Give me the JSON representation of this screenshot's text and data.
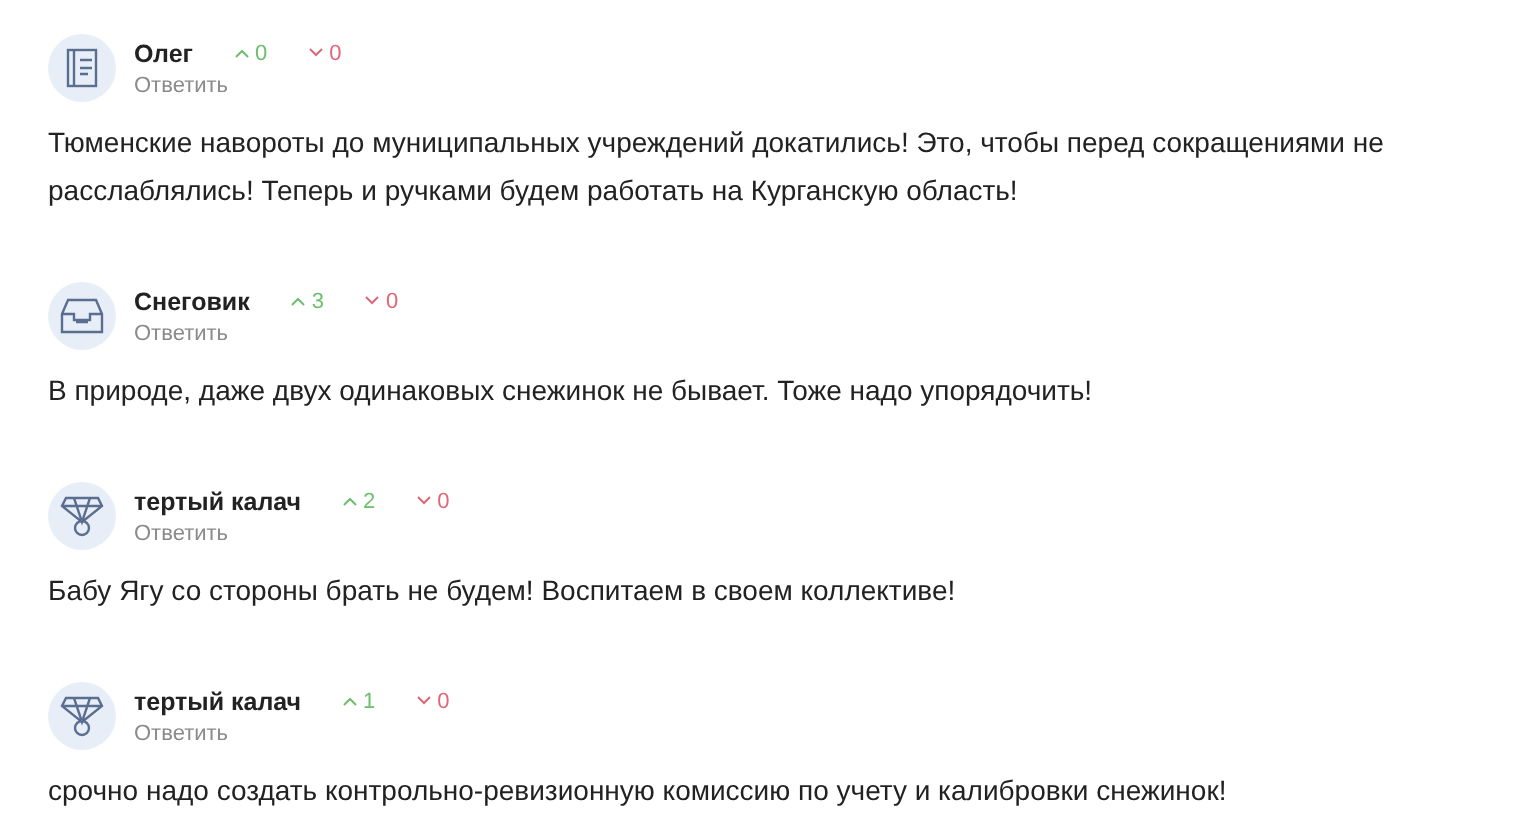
{
  "comments": [
    {
      "author": "Олег",
      "kind": "book",
      "upvotes": "0",
      "downvotes": "0",
      "reply": "Ответить",
      "text": "Тюменские навороты до муниципальных учреждений докатились! Это, чтобы перед сокращениями не расслаблялись! Теперь и ручками будем работать на Курганскую область!"
    },
    {
      "author": "Снеговик",
      "kind": "tray",
      "upvotes": "3",
      "downvotes": "0",
      "reply": "Ответить",
      "text": "В природе, даже двух одинаковых снежинок не бывает. Тоже надо упорядочить!"
    },
    {
      "author": "тертый калач",
      "kind": "medal",
      "upvotes": "2",
      "downvotes": "0",
      "reply": "Ответить",
      "text": "Бабу Ягу со стороны брать не будем! Воспитаем в своем коллективе!"
    },
    {
      "author": "тертый калач",
      "kind": "medal",
      "upvotes": "1",
      "downvotes": "0",
      "reply": "Ответить",
      "text": "срочно надо создать контрольно-ревизионную комиссию по учету и калибровки снежинок!"
    }
  ]
}
